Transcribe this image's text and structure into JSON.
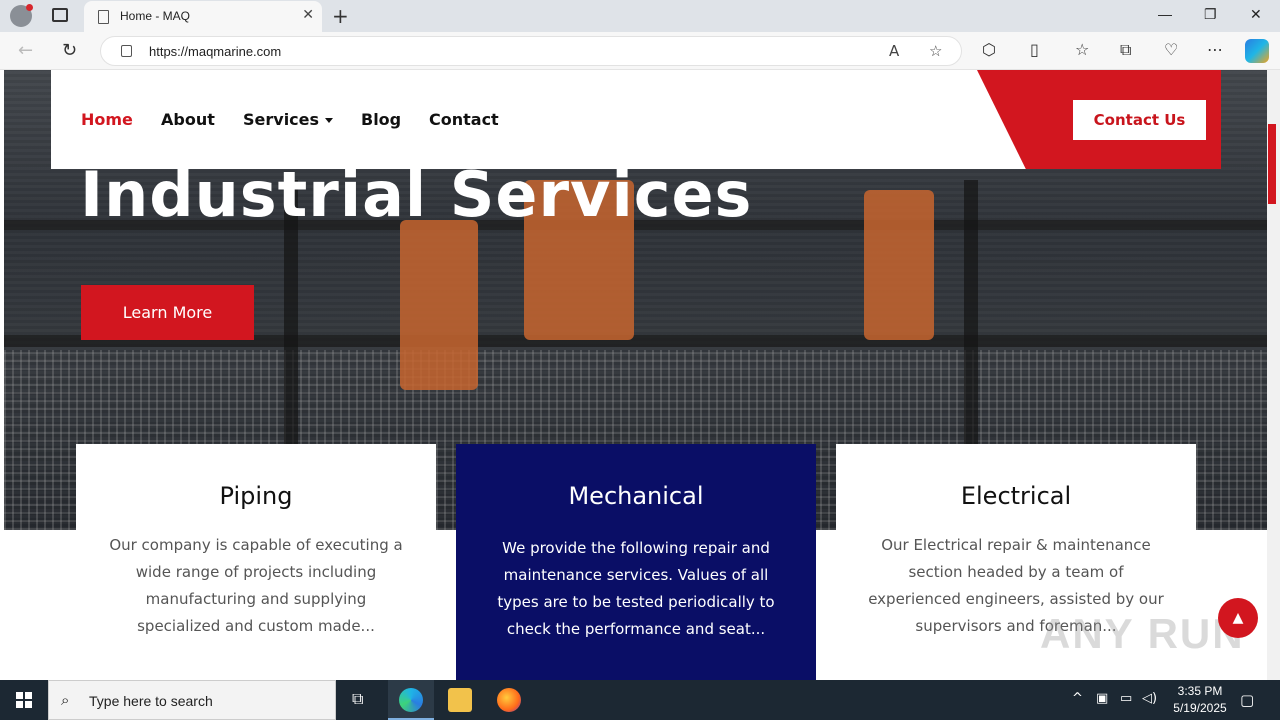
{
  "browser": {
    "tab_title": "Home - MAQ",
    "url": "https://maqmarine.com",
    "tab_close": "✕",
    "new_tab": "+"
  },
  "nav": {
    "items": [
      "Home",
      "About",
      "Services",
      "Blog",
      "Contact"
    ],
    "active": "Home",
    "contact_button": "Contact Us"
  },
  "hero": {
    "title": "Industrial Services",
    "button": "Learn More"
  },
  "cards": [
    {
      "title": "Piping",
      "text": "Our company is capable of executing a wide range of projects including manufacturing and supplying specialized and custom made..."
    },
    {
      "title": "Mechanical",
      "text": "We provide the following repair and maintenance services. Values of all types are to be tested periodically to check the performance and seat..."
    },
    {
      "title": "Electrical",
      "text": "Our Electrical repair & maintenance section headed by a team of experienced engineers, assisted by our supervisors and foreman..."
    }
  ],
  "watermark": "ANY RUN",
  "taskbar": {
    "search_placeholder": "Type here to search",
    "time": "3:35 PM",
    "date": "5/19/2025"
  },
  "colors": {
    "brand_red": "#d2161f",
    "card_dark": "#0a0e66"
  }
}
